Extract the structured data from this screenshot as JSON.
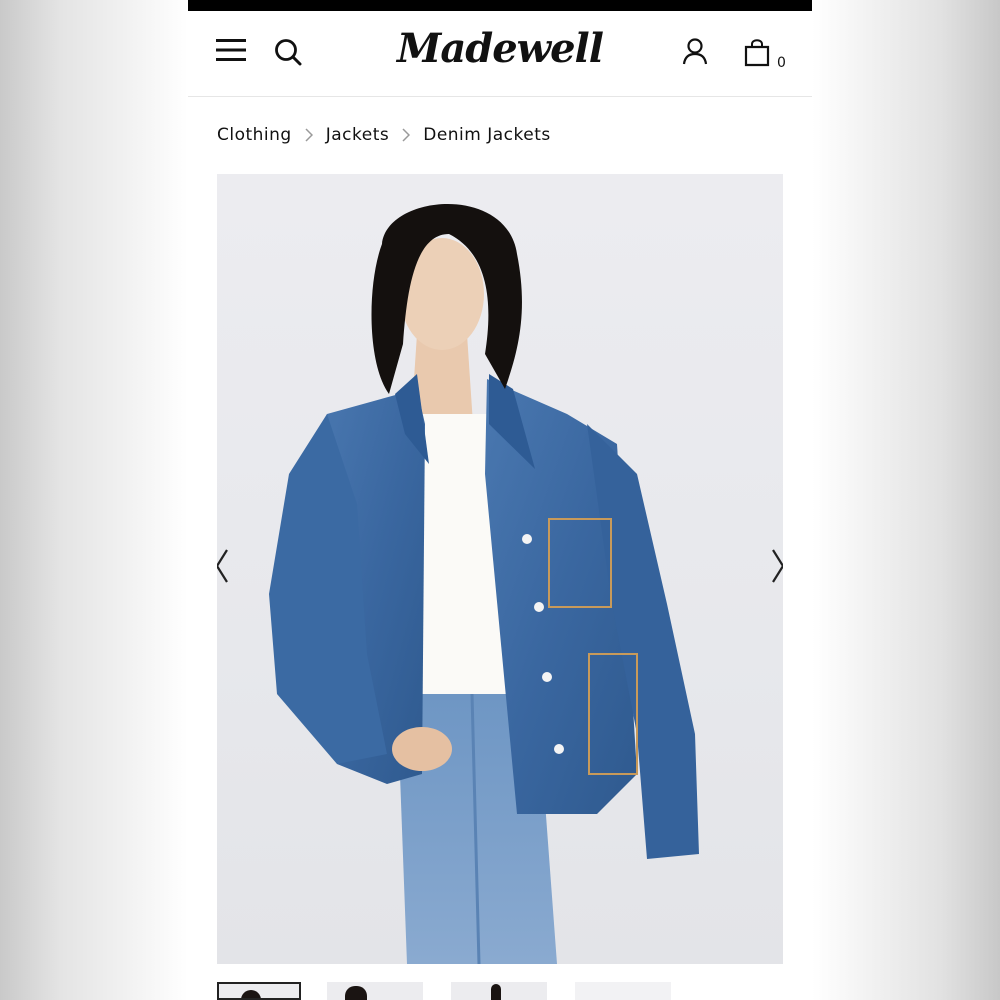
{
  "header": {
    "logo": "Madewell",
    "cart_count": "0"
  },
  "breadcrumb": [
    "Clothing",
    "Jackets",
    "Denim Jackets"
  ],
  "icons": {
    "menu": "hamburger-menu-icon",
    "search": "search-icon",
    "account": "user-icon",
    "cart": "shopping-bag-icon",
    "prev": "chevron-left-icon",
    "next": "chevron-right-icon"
  },
  "colors": {
    "status_bar": "#000000",
    "denim": "#3f6da6",
    "photo_background": "#e8e9ec"
  },
  "thumbnails_count": 4
}
